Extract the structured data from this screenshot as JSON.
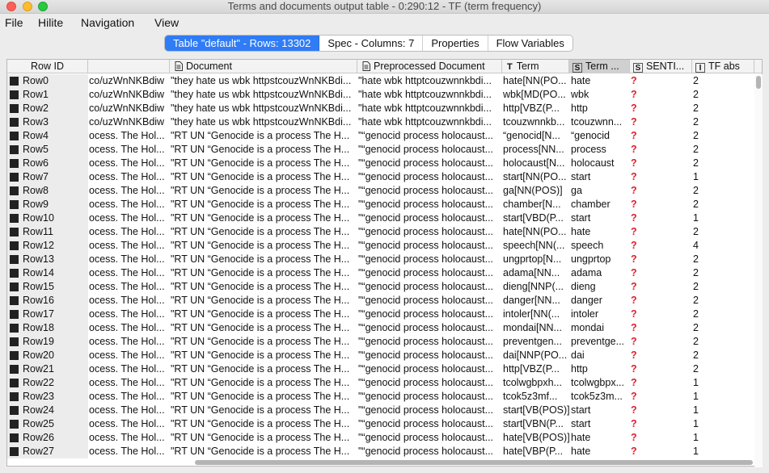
{
  "window": {
    "title": "Terms and documents output table - 0:290:12 - TF (term frequency)"
  },
  "menubar": {
    "items": [
      "File",
      "Hilite",
      "Navigation",
      "View"
    ]
  },
  "tabs": [
    {
      "label": "Table \"default\" - Rows: 13302",
      "active": true
    },
    {
      "label": "Spec - Columns: 7",
      "active": false
    },
    {
      "label": "Properties",
      "active": false
    },
    {
      "label": "Flow Variables",
      "active": false
    }
  ],
  "table": {
    "columns": [
      {
        "label": "Row ID",
        "type_icon": ""
      },
      {
        "label": "",
        "type_icon": ""
      },
      {
        "label": "Document",
        "type_icon": "document-icon"
      },
      {
        "label": "Preprocessed Document",
        "type_icon": "document-icon"
      },
      {
        "label": "Term",
        "type_icon": "T"
      },
      {
        "label": "Term ...",
        "type_icon": "S"
      },
      {
        "label": "SENTI...",
        "type_icon": "S"
      },
      {
        "label": "TF abs",
        "type_icon": "I"
      }
    ],
    "rows": [
      {
        "id": "Row0",
        "c1": "co/uzWnNKBdiw",
        "doc": "\"they hate us wbk httpstcouzWnNKBdi...",
        "pre": "\"hate wbk httptcouzwnnkbdi...",
        "term": "hate[NN(PO...",
        "term2": "hate",
        "senti": "?",
        "tf": "2"
      },
      {
        "id": "Row1",
        "c1": "co/uzWnNKBdiw",
        "doc": "\"they hate us wbk httpstcouzWnNKBdi...",
        "pre": "\"hate wbk httptcouzwnnkbdi...",
        "term": "wbk[MD(PO...",
        "term2": "wbk",
        "senti": "?",
        "tf": "2"
      },
      {
        "id": "Row2",
        "c1": "co/uzWnNKBdiw",
        "doc": "\"they hate us wbk httpstcouzWnNKBdi...",
        "pre": "\"hate wbk httptcouzwnnkbdi...",
        "term": "http[VBZ(P...",
        "term2": "http",
        "senti": "?",
        "tf": "2"
      },
      {
        "id": "Row3",
        "c1": "co/uzWnNKBdiw",
        "doc": "\"they hate us wbk httpstcouzWnNKBdi...",
        "pre": "\"hate wbk httptcouzwnnkbdi...",
        "term": "tcouzwnnkb...",
        "term2": "tcouzwnn...",
        "senti": "?",
        "tf": "2"
      },
      {
        "id": "Row4",
        "c1": "ocess. The Hol...",
        "doc": "\"RT UN “Genocide is a process The H...",
        "pre": "\"“genocid process holocaust...",
        "term": "“genocid[N...",
        "term2": "“genocid",
        "senti": "?",
        "tf": "2"
      },
      {
        "id": "Row5",
        "c1": "ocess. The Hol...",
        "doc": "\"RT UN “Genocide is a process The H...",
        "pre": "\"“genocid process holocaust...",
        "term": "process[NN...",
        "term2": "process",
        "senti": "?",
        "tf": "2"
      },
      {
        "id": "Row6",
        "c1": "ocess. The Hol...",
        "doc": "\"RT UN “Genocide is a process The H...",
        "pre": "\"“genocid process holocaust...",
        "term": "holocaust[N...",
        "term2": "holocaust",
        "senti": "?",
        "tf": "2"
      },
      {
        "id": "Row7",
        "c1": "ocess. The Hol...",
        "doc": "\"RT UN “Genocide is a process The H...",
        "pre": "\"“genocid process holocaust...",
        "term": "start[NN(PO...",
        "term2": "start",
        "senti": "?",
        "tf": "1"
      },
      {
        "id": "Row8",
        "c1": "ocess. The Hol...",
        "doc": "\"RT UN “Genocide is a process The H...",
        "pre": "\"“genocid process holocaust...",
        "term": "ga[NN(POS)]",
        "term2": "ga",
        "senti": "?",
        "tf": "2"
      },
      {
        "id": "Row9",
        "c1": "ocess. The Hol...",
        "doc": "\"RT UN “Genocide is a process The H...",
        "pre": "\"“genocid process holocaust...",
        "term": "chamber[N...",
        "term2": "chamber",
        "senti": "?",
        "tf": "2"
      },
      {
        "id": "Row10",
        "c1": "ocess. The Hol...",
        "doc": "\"RT UN “Genocide is a process The H...",
        "pre": "\"“genocid process holocaust...",
        "term": "start[VBD(P...",
        "term2": "start",
        "senti": "?",
        "tf": "1"
      },
      {
        "id": "Row11",
        "c1": "ocess. The Hol...",
        "doc": "\"RT UN “Genocide is a process The H...",
        "pre": "\"“genocid process holocaust...",
        "term": "hate[NN(PO...",
        "term2": "hate",
        "senti": "?",
        "tf": "2"
      },
      {
        "id": "Row12",
        "c1": "ocess. The Hol...",
        "doc": "\"RT UN “Genocide is a process The H...",
        "pre": "\"“genocid process holocaust...",
        "term": "speech[NN(...",
        "term2": "speech",
        "senti": "?",
        "tf": "4"
      },
      {
        "id": "Row13",
        "c1": "ocess. The Hol...",
        "doc": "\"RT UN “Genocide is a process The H...",
        "pre": "\"“genocid process holocaust...",
        "term": "ungprtop[N...",
        "term2": "ungprtop",
        "senti": "?",
        "tf": "2"
      },
      {
        "id": "Row14",
        "c1": "ocess. The Hol...",
        "doc": "\"RT UN “Genocide is a process The H...",
        "pre": "\"“genocid process holocaust...",
        "term": "adama[NN...",
        "term2": "adama",
        "senti": "?",
        "tf": "2"
      },
      {
        "id": "Row15",
        "c1": "ocess. The Hol...",
        "doc": "\"RT UN “Genocide is a process The H...",
        "pre": "\"“genocid process holocaust...",
        "term": "dieng[NNP(...",
        "term2": "dieng",
        "senti": "?",
        "tf": "2"
      },
      {
        "id": "Row16",
        "c1": "ocess. The Hol...",
        "doc": "\"RT UN “Genocide is a process The H...",
        "pre": "\"“genocid process holocaust...",
        "term": "danger[NN...",
        "term2": "danger",
        "senti": "?",
        "tf": "2"
      },
      {
        "id": "Row17",
        "c1": "ocess. The Hol...",
        "doc": "\"RT UN “Genocide is a process The H...",
        "pre": "\"“genocid process holocaust...",
        "term": "intoler[NN(...",
        "term2": "intoler",
        "senti": "?",
        "tf": "2"
      },
      {
        "id": "Row18",
        "c1": "ocess. The Hol...",
        "doc": "\"RT UN “Genocide is a process The H...",
        "pre": "\"“genocid process holocaust...",
        "term": "mondai[NN...",
        "term2": "mondai",
        "senti": "?",
        "tf": "2"
      },
      {
        "id": "Row19",
        "c1": "ocess. The Hol...",
        "doc": "\"RT UN “Genocide is a process The H...",
        "pre": "\"“genocid process holocaust...",
        "term": "preventgen...",
        "term2": "preventge...",
        "senti": "?",
        "tf": "2"
      },
      {
        "id": "Row20",
        "c1": "ocess. The Hol...",
        "doc": "\"RT UN “Genocide is a process The H...",
        "pre": "\"“genocid process holocaust...",
        "term": "dai[NNP(PO...",
        "term2": "dai",
        "senti": "?",
        "tf": "2"
      },
      {
        "id": "Row21",
        "c1": "ocess. The Hol...",
        "doc": "\"RT UN “Genocide is a process The H...",
        "pre": "\"“genocid process holocaust...",
        "term": "http[VBZ(P...",
        "term2": "http",
        "senti": "?",
        "tf": "2"
      },
      {
        "id": "Row22",
        "c1": "ocess. The Hol...",
        "doc": "\"RT UN “Genocide is a process The H...",
        "pre": "\"“genocid process holocaust...",
        "term": "tcolwgbpxh...",
        "term2": "tcolwgbpx...",
        "senti": "?",
        "tf": "1"
      },
      {
        "id": "Row23",
        "c1": "ocess. The Hol...",
        "doc": "\"RT UN “Genocide is a process The H...",
        "pre": "\"“genocid process holocaust...",
        "term": "tcok5z3mf...",
        "term2": "tcok5z3m...",
        "senti": "?",
        "tf": "1"
      },
      {
        "id": "Row24",
        "c1": "ocess. The Hol...",
        "doc": "\"RT UN “Genocide is a process The H...",
        "pre": "\"“genocid process holocaust...",
        "term": "start[VB(POS)]",
        "term2": "start",
        "senti": "?",
        "tf": "1"
      },
      {
        "id": "Row25",
        "c1": "ocess. The Hol...",
        "doc": "\"RT UN “Genocide is a process The H...",
        "pre": "\"“genocid process holocaust...",
        "term": "start[VBN(P...",
        "term2": "start",
        "senti": "?",
        "tf": "1"
      },
      {
        "id": "Row26",
        "c1": "ocess. The Hol...",
        "doc": "\"RT UN “Genocide is a process The H...",
        "pre": "\"“genocid process holocaust...",
        "term": "hate[VB(POS)]",
        "term2": "hate",
        "senti": "?",
        "tf": "1"
      },
      {
        "id": "Row27",
        "c1": "ocess. The Hol...",
        "doc": "\"RT UN “Genocide is a process The H...",
        "pre": "\"“genocid process holocaust...",
        "term": "hate[VBP(P...",
        "term2": "hate",
        "senti": "?",
        "tf": "1"
      }
    ]
  },
  "colors": {
    "accent": "#2f7cf6",
    "missing_value": "#e0202d"
  }
}
